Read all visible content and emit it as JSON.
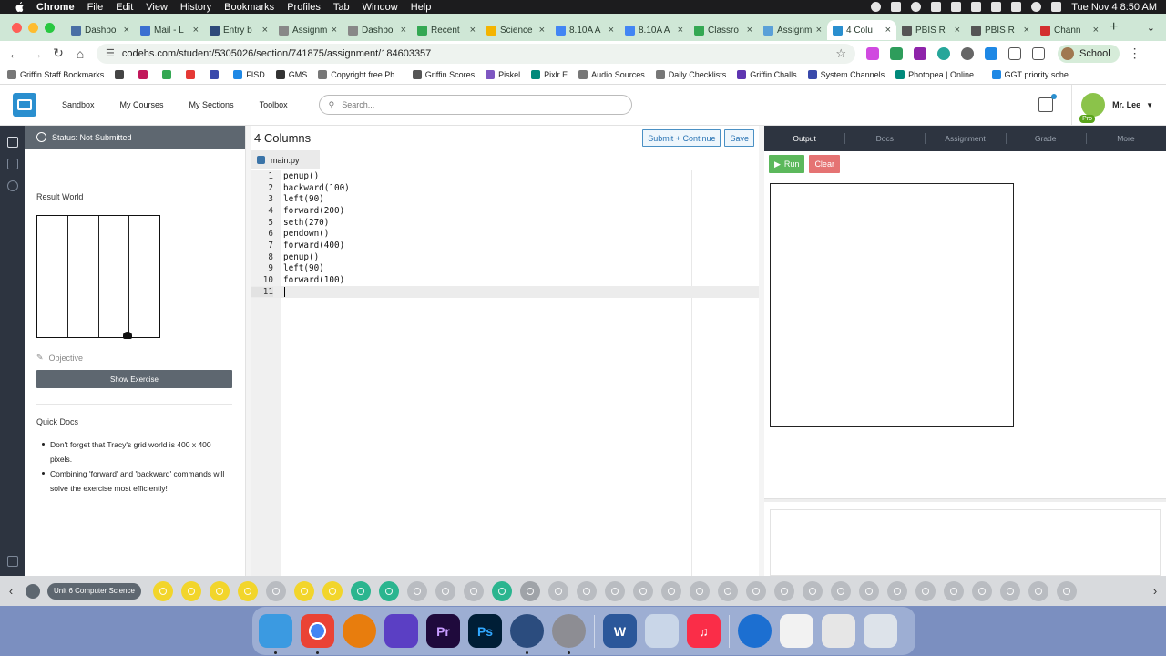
{
  "menubar": {
    "app": "Chrome",
    "items": [
      "File",
      "Edit",
      "View",
      "History",
      "Bookmarks",
      "Profiles",
      "Tab",
      "Window",
      "Help"
    ],
    "datetime": "Tue Nov 4  8:50 AM"
  },
  "tabs": [
    {
      "title": "Dashbo",
      "color": "#4a6fa5"
    },
    {
      "title": "Mail - L",
      "color": "#3b6fd1"
    },
    {
      "title": "Entry b",
      "color": "#2e4a7a"
    },
    {
      "title": "Assignm",
      "color": "#888888"
    },
    {
      "title": "Dashbo",
      "color": "#888888"
    },
    {
      "title": "Recent",
      "color": "#34a853"
    },
    {
      "title": "Science",
      "color": "#f4b400"
    },
    {
      "title": "8.10A A",
      "color": "#4285f4"
    },
    {
      "title": "8.10A A",
      "color": "#4285f4"
    },
    {
      "title": "Classro",
      "color": "#34a853"
    },
    {
      "title": "Assignm",
      "color": "#5aa0d8"
    },
    {
      "title": "4 Colu",
      "color": "#2a8fcf",
      "active": true
    },
    {
      "title": "PBIS R",
      "color": "#555555"
    },
    {
      "title": "PBIS R",
      "color": "#555555"
    },
    {
      "title": "Chann",
      "color": "#d32f2f"
    }
  ],
  "address": {
    "url": "codehs.com/student/5305026/section/741875/assignment/184603357"
  },
  "profile": {
    "label": "School"
  },
  "bookmarks": [
    {
      "label": "Griffin Staff Bookmarks",
      "color": "#777777"
    },
    {
      "label": "",
      "color": "#444444"
    },
    {
      "label": "",
      "color": "#c2185b"
    },
    {
      "label": "",
      "color": "#34a853"
    },
    {
      "label": "",
      "color": "#e53935"
    },
    {
      "label": "",
      "color": "#3949ab"
    },
    {
      "label": "FISD",
      "color": "#1e88e5"
    },
    {
      "label": "GMS",
      "color": "#333333"
    },
    {
      "label": "Copyright free Ph...",
      "color": "#777777"
    },
    {
      "label": "Griffin Scores",
      "color": "#555555"
    },
    {
      "label": "Piskel",
      "color": "#7e57c2"
    },
    {
      "label": "Pixlr E",
      "color": "#00897b"
    },
    {
      "label": "Audio Sources",
      "color": "#777777"
    },
    {
      "label": "Daily Checklists",
      "color": "#777777"
    },
    {
      "label": "Griffin Challs",
      "color": "#5e35b1"
    },
    {
      "label": "System Channels",
      "color": "#3949ab"
    },
    {
      "label": "Photopea | Online...",
      "color": "#00897b"
    },
    {
      "label": "GGT priority sche...",
      "color": "#1e88e5"
    }
  ],
  "topnav": {
    "links": [
      "Sandbox",
      "My Courses",
      "My Sections",
      "Toolbox"
    ],
    "search_placeholder": "Search...",
    "user": "Mr. Lee",
    "pro": "Pro"
  },
  "leftpanel": {
    "status": "Status: Not Submitted",
    "result_world": "Result World",
    "objective": "Objective",
    "show_exercise": "Show Exercise",
    "quick_docs_title": "Quick Docs",
    "quick_docs": [
      "Don't forget that Tracy's grid world is 400 x 400 pixels.",
      "Combining 'forward' and 'backward' commands will solve the exercise most efficiently!"
    ]
  },
  "editor": {
    "title": "4 Columns",
    "submit": "Submit + Continue",
    "save": "Save",
    "file_tab": "main.py",
    "lines": [
      {
        "n": "1",
        "code": "penup()"
      },
      {
        "n": "2",
        "code": "backward(100)"
      },
      {
        "n": "3",
        "code": "left(90)"
      },
      {
        "n": "4",
        "code": "forward(200)"
      },
      {
        "n": "5",
        "code": "seth(270)"
      },
      {
        "n": "6",
        "code": "pendown()"
      },
      {
        "n": "7",
        "code": "forward(400)"
      },
      {
        "n": "8",
        "code": "penup()"
      },
      {
        "n": "9",
        "code": "left(90)"
      },
      {
        "n": "10",
        "code": "forward(100)"
      },
      {
        "n": "11",
        "code": ""
      }
    ],
    "current_line": 11
  },
  "rightpanel": {
    "tabs": [
      "Output",
      "Docs",
      "Assignment",
      "Grade",
      "More"
    ],
    "active_tab": "Output",
    "run": "Run",
    "clear": "Clear"
  },
  "bottombar": {
    "unit": "Unit 6 Computer Science"
  },
  "colors": {
    "dark_panel": "#2d3440",
    "status_gray": "#5e6770",
    "run_green": "#5cb85c",
    "clear_red": "#e57373",
    "codehs_blue": "#2a8fcf"
  }
}
